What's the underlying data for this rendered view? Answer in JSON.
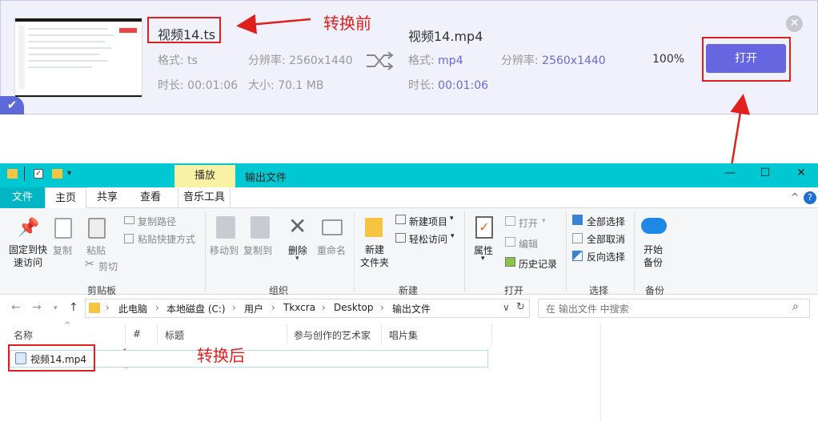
{
  "converter": {
    "before": {
      "filename": "视频14.ts",
      "format_label": "格式: ts",
      "resolution_label": "分辨率: 2560x1440",
      "duration_label": "时长: 00:01:06",
      "size_label": "大小: 70.1 MB"
    },
    "after": {
      "filename": "视频14.mp4",
      "format_key": "格式:",
      "format_val": "mp4",
      "resolution_key": "分辨率:",
      "resolution_val": "2560x1440",
      "duration_key": "时长:",
      "duration_val": "00:01:06"
    },
    "progress": "100%",
    "progress_value": 1.0,
    "open_button": "打开",
    "check_icon": "✔",
    "close_icon": "✕"
  },
  "annotations": {
    "before_label": "转换前",
    "after_label": "转换后",
    "highlight_color": "#e0201c"
  },
  "explorer": {
    "contextual_tab": "播放",
    "window_title": "输出文件",
    "tabs": [
      "文件",
      "主页",
      "共享",
      "查看",
      "音乐工具"
    ],
    "ribbon": {
      "clipboard": {
        "pin": "固定到快\n速访问",
        "copy": "复制",
        "paste": "粘贴",
        "copy_path": "复制路径",
        "paste_shortcut": "粘贴快捷方式",
        "cut": "剪切",
        "group": "剪贴板"
      },
      "organize": {
        "move_to": "移动到",
        "copy_to": "复制到",
        "delete": "删除",
        "rename": "重命名",
        "group": "组织"
      },
      "new": {
        "new_item": "新建项目",
        "easy_access": "轻松访问",
        "new_folder": "新建\n文件夹",
        "group": "新建"
      },
      "open": {
        "properties": "属性",
        "open": "打开",
        "edit": "编辑",
        "history": "历史记录",
        "group": "打开"
      },
      "select": {
        "select_all": "全部选择",
        "select_none": "全部取消",
        "invert": "反向选择",
        "group": "选择"
      },
      "backup": {
        "start_backup": "开始\n备份",
        "group": "备份"
      }
    },
    "breadcrumb": [
      "此电脑",
      "本地磁盘 (C:)",
      "用户",
      "Tkxcra",
      "Desktop",
      "输出文件"
    ],
    "search_placeholder": "在 输出文件 中搜索",
    "columns": [
      "名称",
      "#",
      "标题",
      "参与创作的艺术家",
      "唱片集"
    ],
    "files": [
      {
        "name": "视频14.mp4"
      }
    ],
    "accent": "#00c8d2"
  }
}
